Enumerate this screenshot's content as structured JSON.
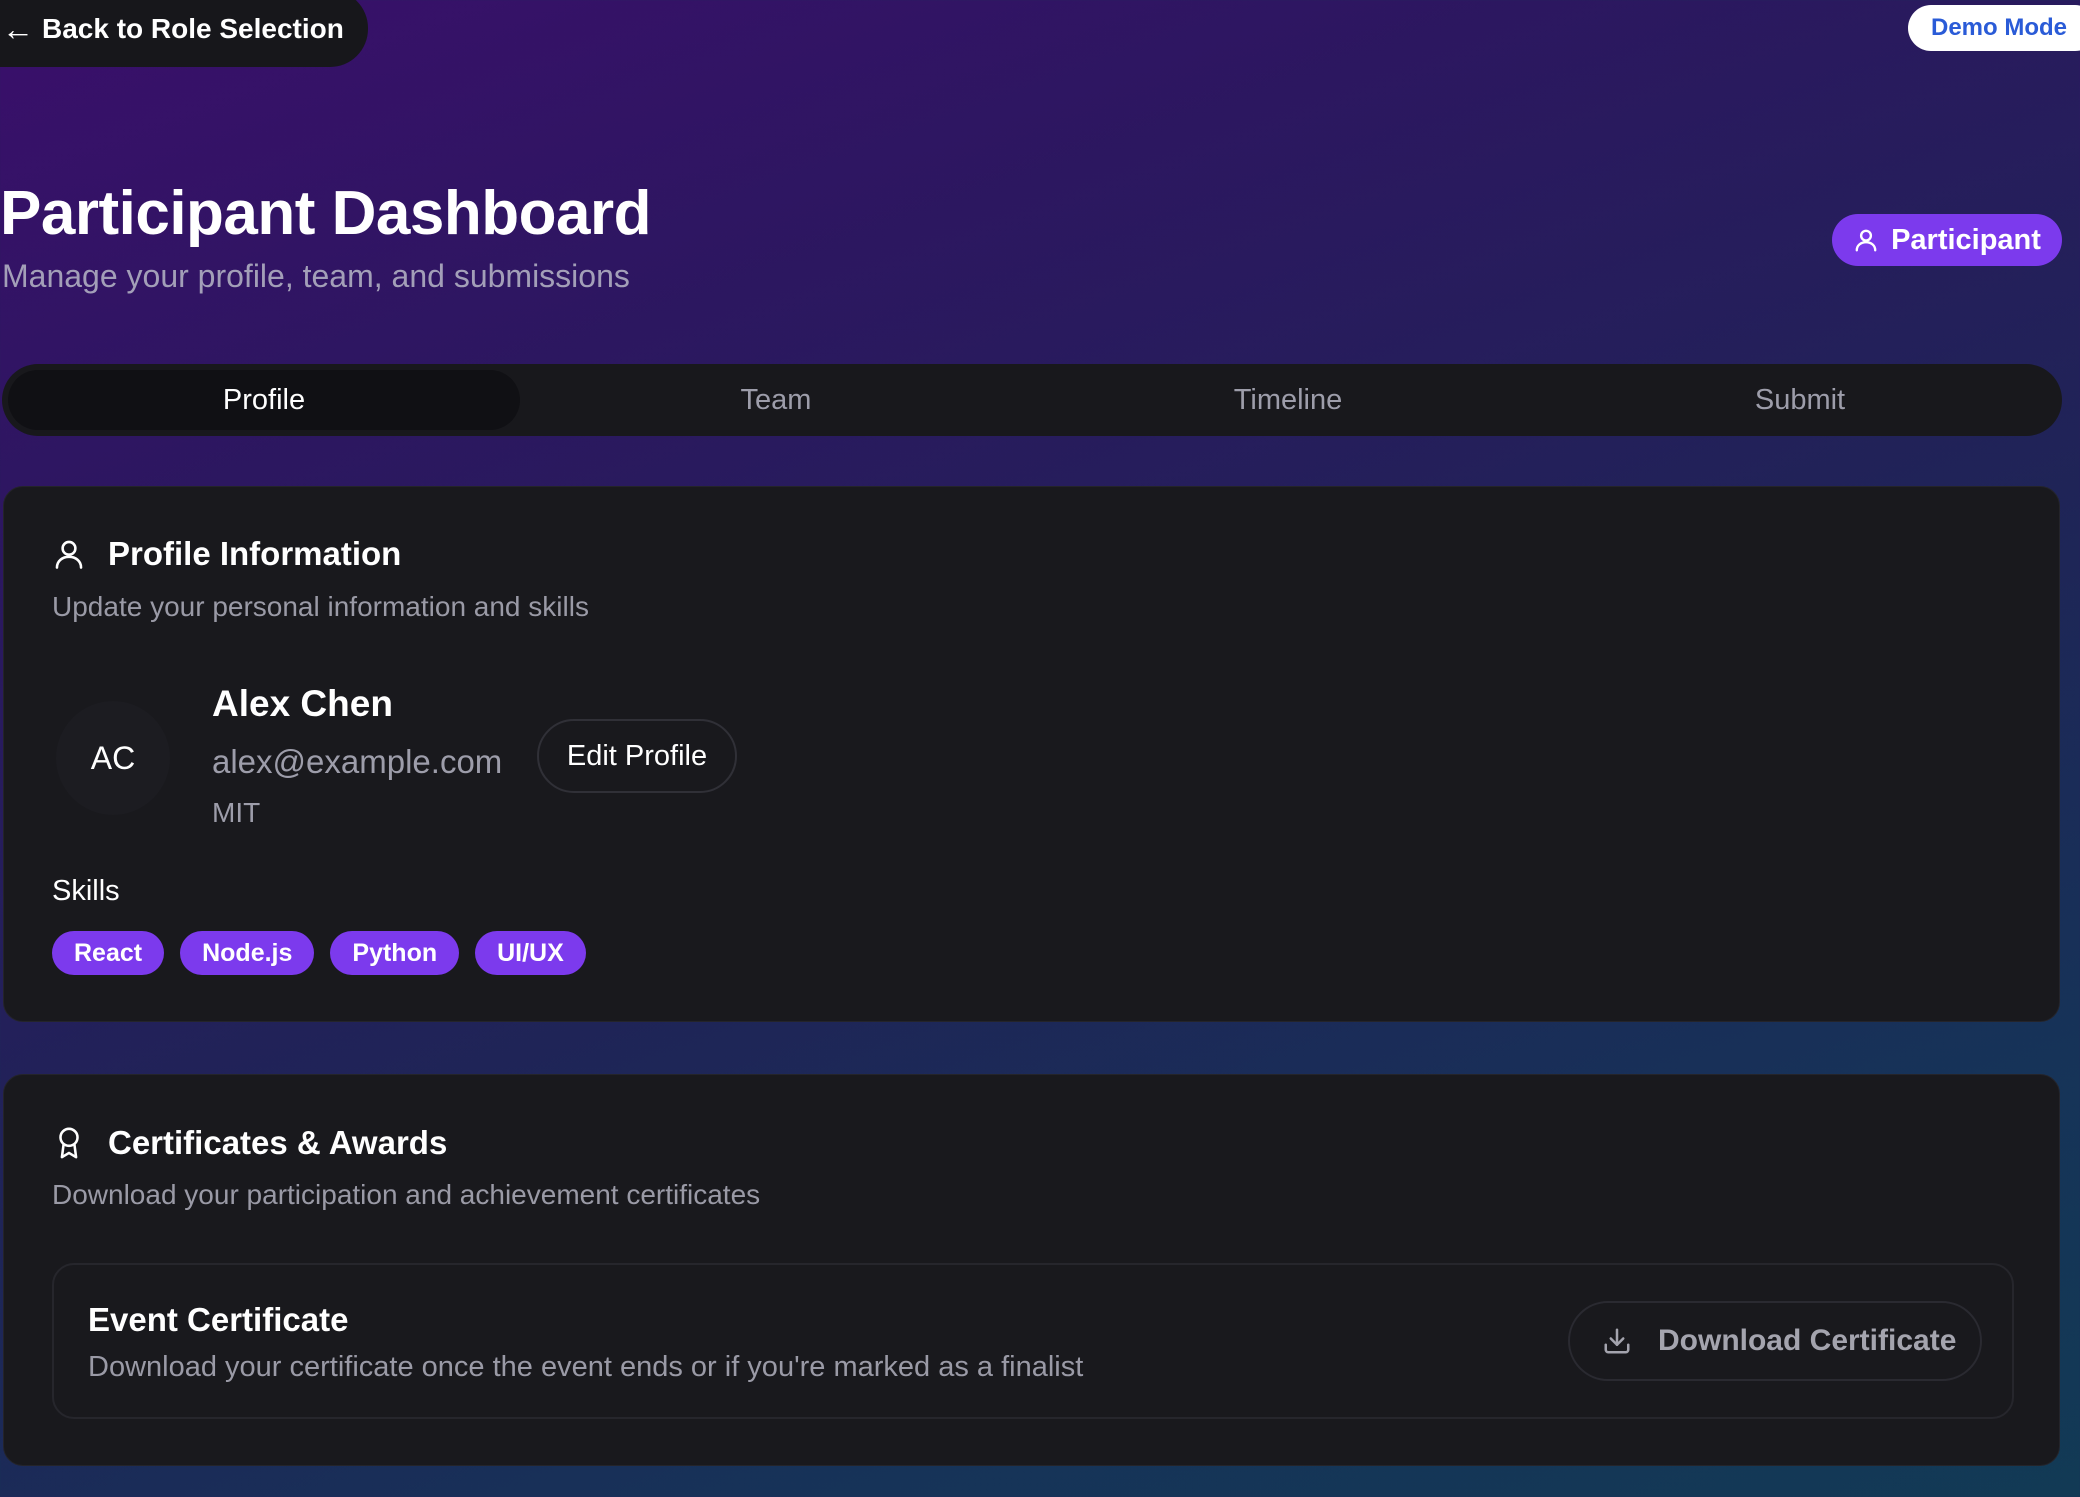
{
  "nav": {
    "back_label": "Back to Role Selection",
    "demo_label": "Demo Mode"
  },
  "header": {
    "title": "Participant Dashboard",
    "subtitle": "Manage your profile, team, and submissions",
    "role_badge": "Participant"
  },
  "tabs": [
    {
      "label": "Profile",
      "active": true
    },
    {
      "label": "Team",
      "active": false
    },
    {
      "label": "Timeline",
      "active": false
    },
    {
      "label": "Submit",
      "active": false
    }
  ],
  "profile_card": {
    "title": "Profile Information",
    "description": "Update your personal information and skills",
    "avatar_initials": "AC",
    "name": "Alex Chen",
    "email": "alex@example.com",
    "school": "MIT",
    "edit_label": "Edit Profile",
    "skills_label": "Skills",
    "skills": [
      "React",
      "Node.js",
      "Python",
      "UI/UX"
    ]
  },
  "cert_card": {
    "title": "Certificates & Awards",
    "description": "Download your participation and achievement certificates",
    "item_title": "Event Certificate",
    "item_description": "Download your certificate once the event ends or if you're marked as a finalist",
    "download_label": "Download Certificate"
  },
  "icons": {
    "back": "arrow-left-icon",
    "role": "user-icon",
    "profile": "user-icon",
    "certificates": "award-icon",
    "download": "download-icon"
  },
  "colors": {
    "accent": "#7c3aed",
    "demo_text": "#2a5bd7",
    "card_bg": "#19191d"
  }
}
